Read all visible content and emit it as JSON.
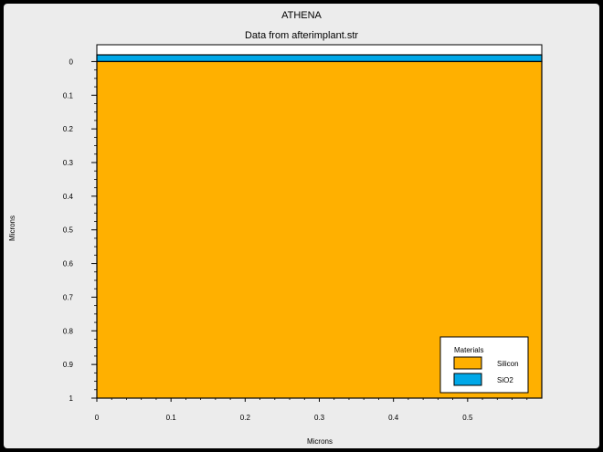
{
  "chart_data": {
    "type": "area",
    "title": "ATHENA",
    "subtitle": "Data from afterimplant.str",
    "xlabel": "Microns",
    "ylabel": "Microns",
    "xlim": [
      0,
      0.6
    ],
    "ylim": [
      -0.05,
      1.0
    ],
    "y_inverted": true,
    "xticks": [
      0,
      0.1,
      0.2,
      0.3,
      0.4,
      0.5
    ],
    "xtick_labels": [
      "0",
      "0.1",
      "0.2",
      "0.3",
      "0.4",
      "0.5"
    ],
    "yticks": [
      0,
      0.1,
      0.2,
      0.3,
      0.4,
      0.5,
      0.6,
      0.7,
      0.8,
      0.9,
      1.0
    ],
    "ytick_labels": [
      "0",
      "0.1",
      "0.2",
      "0.3",
      "0.4",
      "0.5",
      "0.6",
      "0.7",
      "0.8",
      "0.9",
      "1"
    ],
    "legend_position": "bottom-right",
    "legend": {
      "title": "Materials",
      "entries": [
        {
          "label": "Silicon",
          "color": "#ffb000"
        },
        {
          "label": "SiO2",
          "color": "#00a8e8"
        }
      ]
    },
    "regions": [
      {
        "material": "SiO2",
        "color": "#00a8e8",
        "x": [
          0,
          0.6
        ],
        "y_top": -0.02,
        "y_bottom": 0.0
      },
      {
        "material": "Silicon",
        "color": "#ffb000",
        "x": [
          0,
          0.6
        ],
        "y_top": 0.0,
        "y_bottom": 1.0
      }
    ],
    "grid": false
  }
}
